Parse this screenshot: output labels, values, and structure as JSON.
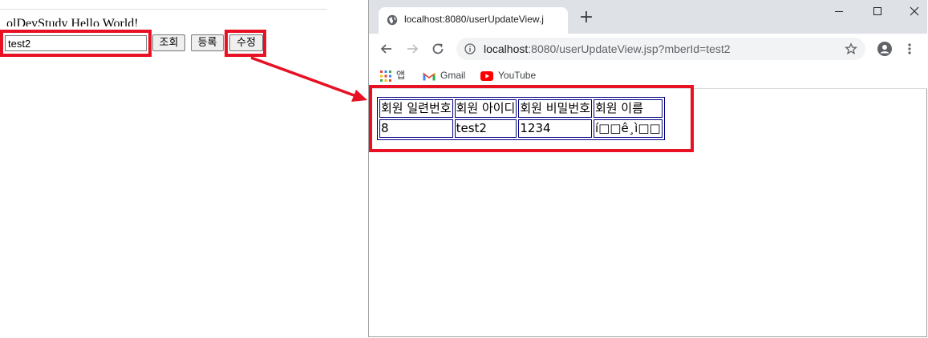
{
  "left_page": {
    "title": "olDevStudy Hello World!",
    "member_id_input": {
      "value": "test2"
    },
    "buttons": {
      "search": "조회",
      "register": "등록",
      "edit": "수정"
    }
  },
  "browser": {
    "tab_title": "localhost:8080/userUpdateView.j",
    "new_tab": "+",
    "address": {
      "host": "localhost",
      "rest": ":8080/userUpdateView.jsp?mberId=test2"
    },
    "bookmarks": [
      {
        "label": "앱",
        "icon": "apps-grid-icon"
      },
      {
        "label": "Gmail",
        "icon": "gmail-icon"
      },
      {
        "label": "YouTube",
        "icon": "youtube-icon"
      }
    ]
  },
  "table": {
    "headers": [
      "회원 일련번호",
      "회원 아이디",
      "회원 비밀번호",
      "회원 이름"
    ],
    "rows": [
      [
        "8",
        "test2",
        "1234",
        "í□□ê¸ì□□"
      ]
    ]
  },
  "colors": {
    "highlight": "#e81123",
    "table_border": "#000080",
    "titlebar": "#dee1e6"
  }
}
